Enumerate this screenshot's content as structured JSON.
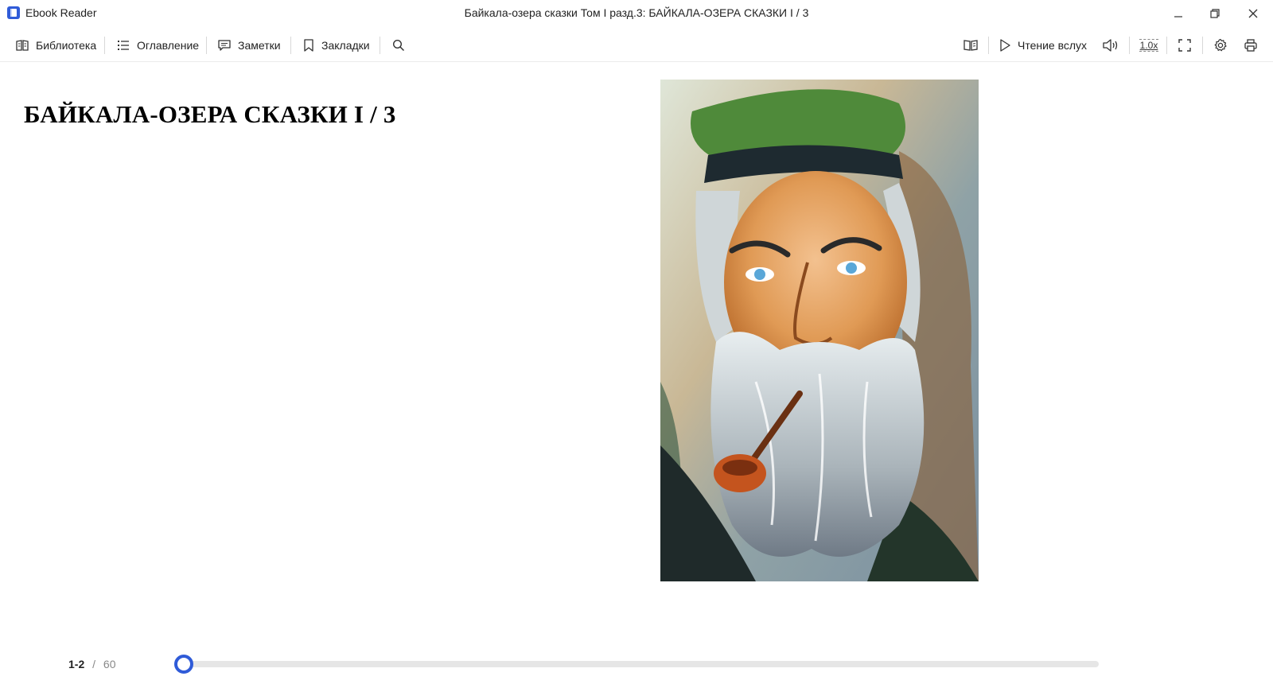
{
  "app": {
    "name": "Ebook Reader",
    "window_title": "Байкала-озера сказки Том I  разд.3: БАЙКАЛА-ОЗЕРА СКАЗКИ I / 3",
    "accent_color": "#2f5bd8"
  },
  "toolbar": {
    "left": [
      {
        "label": "Библиотека",
        "icon": "library-icon"
      },
      {
        "label": "Оглавление",
        "icon": "table-of-contents-icon"
      },
      {
        "label": "Заметки",
        "icon": "notes-icon"
      },
      {
        "label": "Закладки",
        "icon": "bookmark-icon"
      }
    ],
    "search_icon": "search-icon",
    "right": {
      "two_page_icon": "two-page-view-icon",
      "read_aloud_label": "Чтение вслух",
      "volume_icon": "volume-icon",
      "speed_label": "1.0x",
      "fullscreen_icon": "fullscreen-icon",
      "settings_icon": "gear-icon",
      "print_icon": "print-icon"
    }
  },
  "content": {
    "chapter_title": "БАЙКАЛА-ОЗЕРА СКАЗКИ I / 3",
    "illustration": "portrait-of-bearded-old-man-with-pipe"
  },
  "footer": {
    "current_pages": "1-2",
    "separator": "/",
    "total_pages": "60",
    "progress_fraction": 0.0
  }
}
